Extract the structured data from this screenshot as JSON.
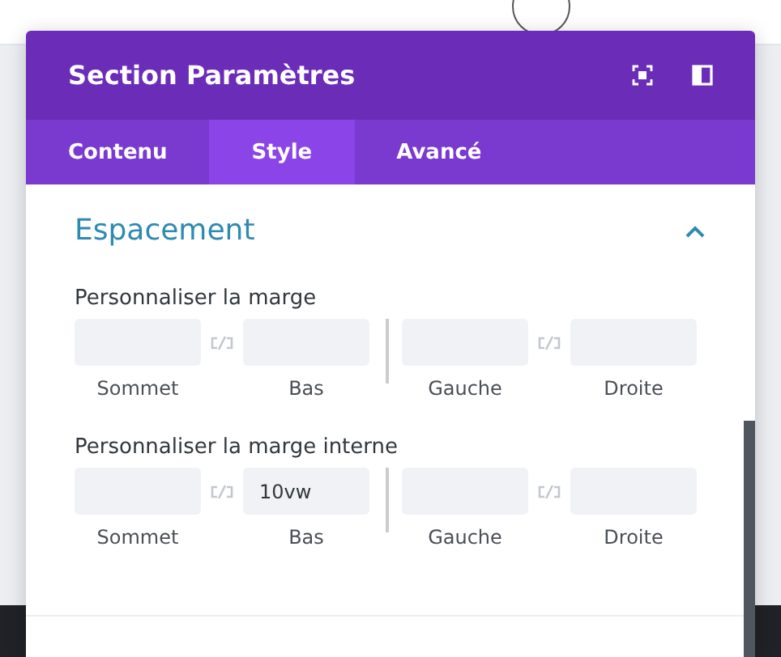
{
  "modal": {
    "title": "Section Paramètres",
    "tabs": [
      {
        "label": "Contenu",
        "selected": false
      },
      {
        "label": "Style",
        "selected": true
      },
      {
        "label": "Avancé",
        "selected": false
      }
    ],
    "section": {
      "title": "Espacement",
      "expanded": true,
      "groups": [
        {
          "label": "Personnaliser la marge",
          "fields": [
            {
              "label": "Sommet"
            },
            {
              "label": "Bas"
            },
            {
              "label": "Gauche"
            },
            {
              "label": "Droite"
            }
          ]
        },
        {
          "label": "Personnaliser la marge interne",
          "fields": [
            {
              "label": "Sommet"
            },
            {
              "label": "Bas",
              "value": "10vw"
            },
            {
              "label": "Gauche"
            },
            {
              "label": "Droite"
            }
          ]
        }
      ]
    }
  }
}
